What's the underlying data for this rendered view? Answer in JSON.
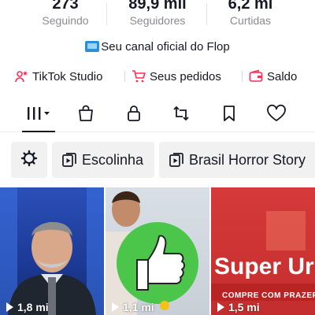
{
  "stats": [
    {
      "value": "273",
      "label": "Seguindo"
    },
    {
      "value": "89,9 mil",
      "label": "Seguidores"
    },
    {
      "value": "6,2 mi",
      "label": "Curtidas"
    }
  ],
  "bio": "Seu canal oficial do Flop",
  "links": [
    {
      "label": "TikTok Studio",
      "icon": "studio-icon",
      "color": "#fe2c55"
    },
    {
      "label": "Seus pedidos",
      "icon": "cart-icon",
      "color": "#fe2c55"
    },
    {
      "label": "Saldo",
      "icon": "wallet-icon",
      "color": "#fe2c55"
    }
  ],
  "tabs": [
    {
      "name": "videos-grid",
      "icon": "grid-icon",
      "active": true
    },
    {
      "name": "shop",
      "icon": "shopping-bag-icon"
    },
    {
      "name": "private",
      "icon": "lock-icon"
    },
    {
      "name": "reposts",
      "icon": "repost-icon"
    },
    {
      "name": "favorites",
      "icon": "bookmark-icon"
    },
    {
      "name": "liked",
      "icon": "heart-icon"
    }
  ],
  "chips": [
    {
      "label": "",
      "icon": "settings-icon"
    },
    {
      "label": "Escolinha",
      "icon": "playlist-icon"
    },
    {
      "label": "Brasil Horror Story",
      "icon": "playlist-icon"
    }
  ],
  "videos": [
    {
      "views": "1,8 mi"
    },
    {
      "views": "1,1 mi"
    },
    {
      "views": "1,5 mi",
      "headline": "Super Ur",
      "subline": "COMPRE COM PRAZER"
    }
  ],
  "colors": {
    "accent": "#fe2c55",
    "text": "#161823",
    "muted": "#8a8b91"
  }
}
